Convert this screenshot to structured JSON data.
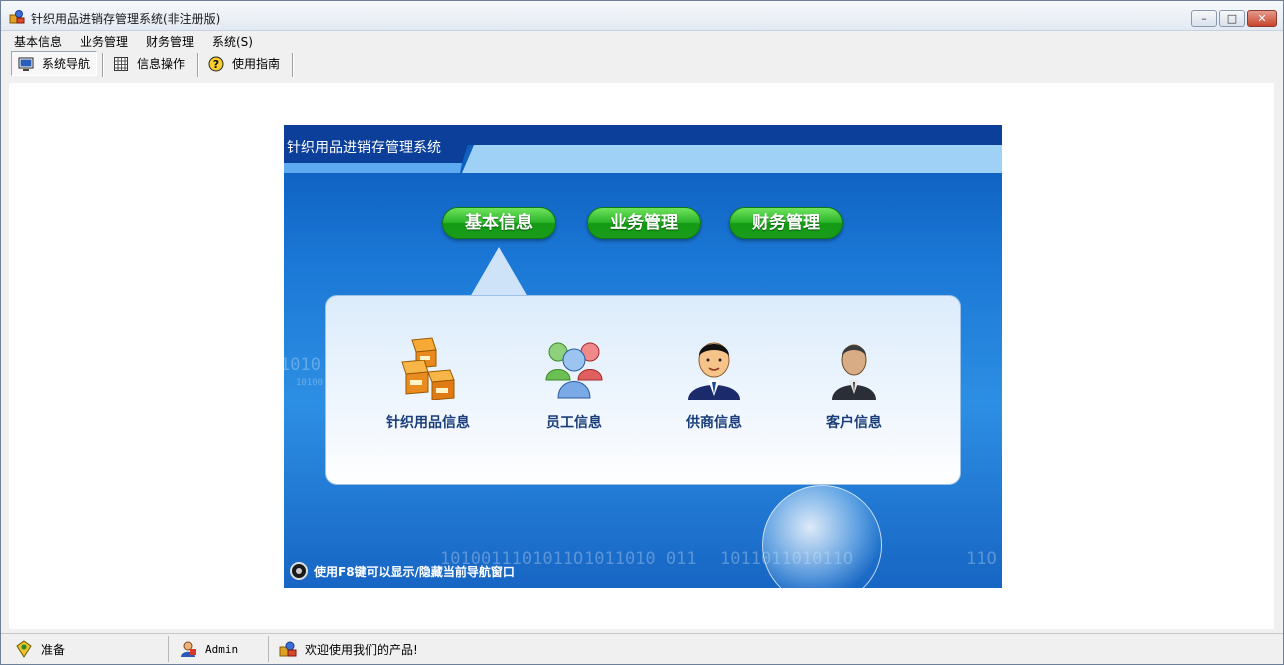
{
  "window": {
    "title": "针织用品进销存管理系统(非注册版)",
    "buttons": {
      "minimize": "–",
      "maximize": "□",
      "close": "✕"
    }
  },
  "menubar": {
    "items": [
      "基本信息",
      "业务管理",
      "财务管理",
      "系统(S)"
    ]
  },
  "toolbar": {
    "items": [
      {
        "label": "系统导航",
        "icon": "monitor-icon",
        "active": true
      },
      {
        "label": "信息操作",
        "icon": "grid-icon",
        "active": false
      },
      {
        "label": "使用指南",
        "icon": "help-icon",
        "active": false
      }
    ]
  },
  "nav": {
    "title": "针织用品进销存管理系统",
    "tabs": [
      "基本信息",
      "业务管理",
      "财务管理"
    ],
    "selected_tab": "基本信息",
    "items": [
      {
        "label": "针织用品信息",
        "icon": "boxes-icon"
      },
      {
        "label": "员工信息",
        "icon": "people-group-icon"
      },
      {
        "label": "供商信息",
        "icon": "businessman-icon"
      },
      {
        "label": "客户信息",
        "icon": "customer-icon"
      }
    ],
    "hint": "使用F8键可以显示/隐藏当前导航窗口",
    "binary_bg": [
      "1010011101011O",
      "1011010  011",
      "101101101011O",
      "11O",
      "1010",
      "10100"
    ]
  },
  "statusbar": {
    "status": "准备",
    "user": "Admin",
    "message": "欢迎使用我们的产品!"
  },
  "colors": {
    "nav_blue": "#1b78d6",
    "button_green": "#2cb52a",
    "label_navy": "#1a3e7a"
  }
}
